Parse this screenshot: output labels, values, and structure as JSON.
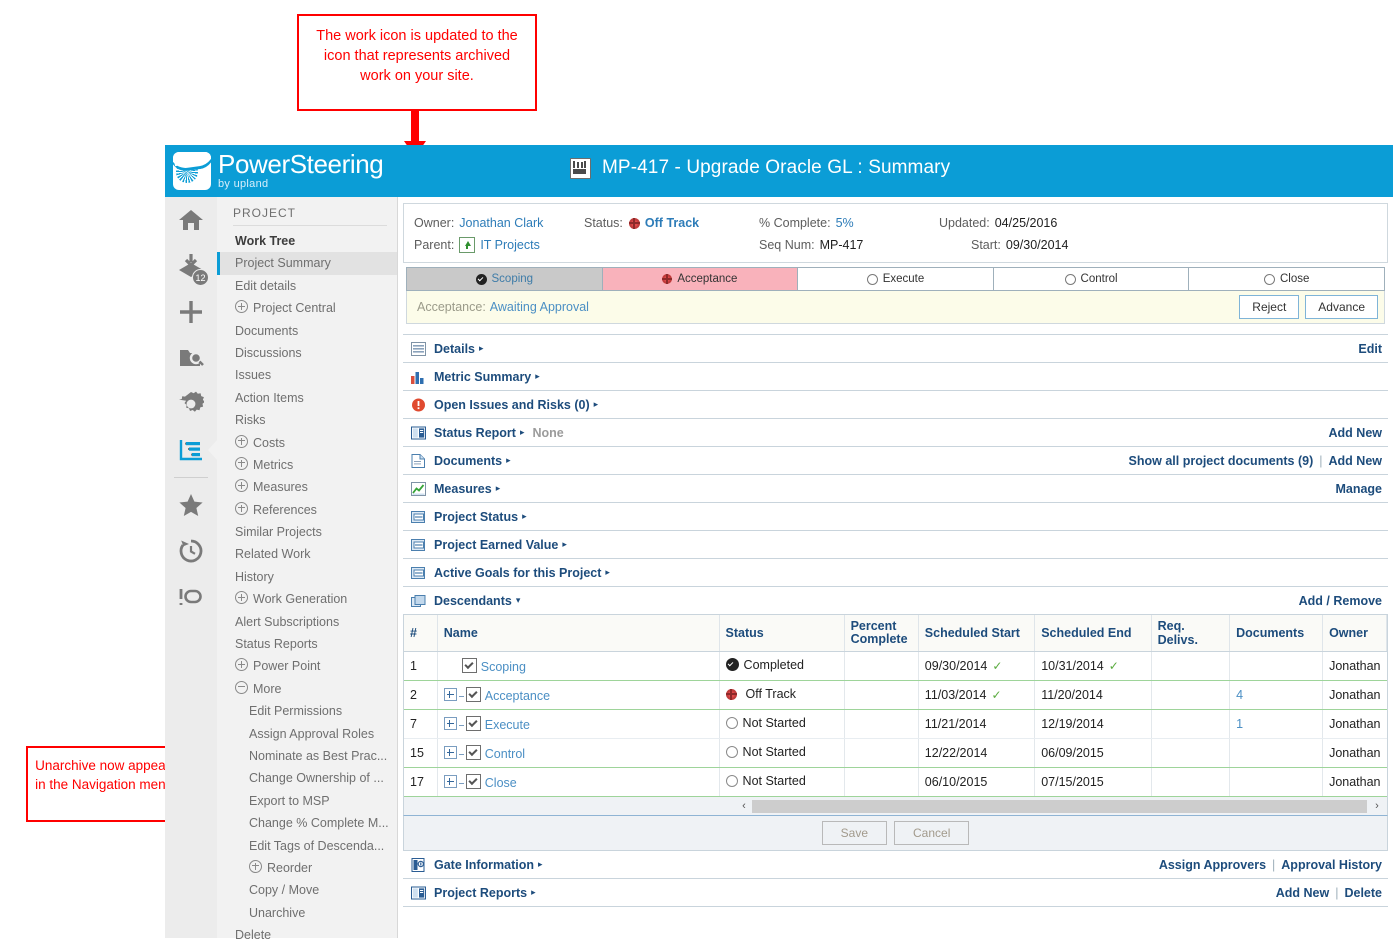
{
  "brand": {
    "name": "PowerSteering",
    "tagline": "by upland",
    "accent": "#0b9dd6"
  },
  "header": {
    "title": "MP-417 - Upgrade Oracle GL : Summary",
    "work_icon": "archive-work-icon"
  },
  "rail": {
    "items": [
      {
        "name": "home-icon"
      },
      {
        "name": "inbox-icon",
        "badge": "12"
      },
      {
        "name": "add-icon"
      },
      {
        "name": "browse-icon"
      },
      {
        "name": "settings-icon"
      },
      {
        "name": "reports-icon",
        "active": true
      },
      {
        "name": "favorites-star-icon"
      },
      {
        "name": "recent-history-icon"
      },
      {
        "name": "links-icon"
      }
    ]
  },
  "nav": {
    "heading": "PROJECT",
    "items": [
      {
        "label": "Work Tree",
        "style": "bold"
      },
      {
        "label": "Project Summary",
        "style": "selected"
      },
      {
        "label": "Edit details"
      },
      {
        "label": "Project Central",
        "toggle": "plus"
      },
      {
        "label": "Documents"
      },
      {
        "label": "Discussions"
      },
      {
        "label": "Issues"
      },
      {
        "label": "Action Items"
      },
      {
        "label": "Risks"
      },
      {
        "label": "Costs",
        "toggle": "plus"
      },
      {
        "label": "Metrics",
        "toggle": "plus"
      },
      {
        "label": "Measures",
        "toggle": "plus"
      },
      {
        "label": "References",
        "toggle": "plus"
      },
      {
        "label": "Similar Projects"
      },
      {
        "label": "Related Work"
      },
      {
        "label": "History"
      },
      {
        "label": "Work Generation",
        "toggle": "plus"
      },
      {
        "label": "Alert Subscriptions"
      },
      {
        "label": "Status Reports"
      },
      {
        "label": "Power Point",
        "toggle": "plus"
      },
      {
        "label": "More",
        "toggle": "minus"
      },
      {
        "label": "Edit Permissions",
        "indent": 1
      },
      {
        "label": "Assign Approval Roles",
        "indent": 1
      },
      {
        "label": "Nominate as Best Prac...",
        "indent": 1
      },
      {
        "label": "Change Ownership of ...",
        "indent": 1
      },
      {
        "label": "Export to MSP",
        "indent": 1
      },
      {
        "label": "Change % Complete M...",
        "indent": 1
      },
      {
        "label": "Edit Tags of Descenda...",
        "indent": 1
      },
      {
        "label": "Reorder",
        "indent": 1,
        "toggle": "plus"
      },
      {
        "label": "Copy / Move",
        "indent": 1
      },
      {
        "label": "Unarchive",
        "indent": 1
      },
      {
        "label": "Delete"
      }
    ]
  },
  "info": {
    "owner_label": "Owner:",
    "owner_value": "Jonathan Clark",
    "status_label": "Status:",
    "status_value": "Off Track",
    "percent_label": "% Complete:",
    "percent_value": "5%",
    "updated_label": "Updated:",
    "updated_value": "04/25/2016",
    "parent_label": "Parent:",
    "parent_value": "IT Projects",
    "seq_label": "Seq Num:",
    "seq_value": "MP-417",
    "start_label": "Start:",
    "start_value": "09/30/2014"
  },
  "phases": [
    {
      "label": "Scoping",
      "state": "done"
    },
    {
      "label": "Acceptance",
      "state": "current"
    },
    {
      "label": "Execute",
      "state": "pending"
    },
    {
      "label": "Control",
      "state": "pending"
    },
    {
      "label": "Close",
      "state": "pending"
    }
  ],
  "approval": {
    "label": "Acceptance:",
    "value": "Awaiting Approval",
    "reject_label": "Reject",
    "advance_label": "Advance"
  },
  "sections": [
    {
      "title": "Details",
      "icon": "grid-icon",
      "caret": "▸",
      "actions": [
        "Edit"
      ]
    },
    {
      "title": "Metric Summary",
      "icon": "bar-chart-icon",
      "caret": "▸",
      "actions": []
    },
    {
      "title": "Open Issues and Risks (0)",
      "icon": "alert-icon",
      "caret": "▸",
      "actions": []
    },
    {
      "title": "Status Report",
      "icon": "book-icon",
      "caret": "▸",
      "note": "None",
      "actions": [
        "Add New"
      ]
    },
    {
      "title": "Documents",
      "icon": "document-icon",
      "caret": "▸",
      "actions": [
        "Show all project documents (9)",
        "Add New"
      ]
    },
    {
      "title": "Measures",
      "icon": "line-chart-icon",
      "caret": "▸",
      "actions": [
        "Manage"
      ]
    },
    {
      "title": "Project Status",
      "icon": "report-icon",
      "caret": "▸",
      "actions": []
    },
    {
      "title": "Project Earned Value",
      "icon": "report-icon",
      "caret": "▸",
      "actions": []
    },
    {
      "title": "Active Goals for this Project",
      "icon": "report-icon",
      "caret": "▸",
      "actions": []
    },
    {
      "title": "Descendants",
      "icon": "stack-icon",
      "caret": "▾",
      "actions": [
        "Add / Remove"
      ]
    }
  ],
  "descendants": {
    "columns": [
      "#",
      "Name",
      "Status",
      "Percent Complete",
      "Scheduled Start",
      "Scheduled End",
      "Req. Delivs.",
      "Documents",
      "Owner"
    ],
    "rows": [
      {
        "num": "1",
        "name": "Scoping",
        "expandable": false,
        "status": "Completed",
        "status_icon": "check-filled",
        "percent": "",
        "start": "09/30/2014",
        "start_check": true,
        "end": "10/31/2014",
        "end_check": true,
        "delivs": "",
        "documents": "",
        "owner": "Jonathan"
      },
      {
        "num": "2",
        "name": "Acceptance",
        "expandable": true,
        "status": "Off Track",
        "status_icon": "off-track",
        "percent": "",
        "start": "11/03/2014",
        "start_check": true,
        "end": "11/20/2014",
        "end_check": false,
        "delivs": "",
        "documents": "4",
        "owner": "Jonathan"
      },
      {
        "num": "7",
        "name": "Execute",
        "expandable": true,
        "status": "Not Started",
        "status_icon": "circle",
        "percent": "",
        "start": "11/21/2014",
        "start_check": false,
        "end": "12/19/2014",
        "end_check": false,
        "delivs": "",
        "documents": "1",
        "owner": "Jonathan"
      },
      {
        "num": "15",
        "name": "Control",
        "expandable": true,
        "status": "Not Started",
        "status_icon": "circle",
        "percent": "",
        "start": "12/22/2014",
        "start_check": false,
        "end": "06/09/2015",
        "end_check": false,
        "delivs": "",
        "documents": "",
        "owner": "Jonathan"
      },
      {
        "num": "17",
        "name": "Close",
        "expandable": true,
        "status": "Not Started",
        "status_icon": "circle",
        "percent": "",
        "start": "06/10/2015",
        "start_check": false,
        "end": "07/15/2015",
        "end_check": false,
        "delivs": "",
        "documents": "",
        "owner": "Jonathan"
      }
    ],
    "scroll_left": "‹",
    "scroll_right": "›"
  },
  "formbar": {
    "save_label": "Save",
    "cancel_label": "Cancel"
  },
  "footer_sections": [
    {
      "title": "Gate Information",
      "icon": "gate-icon",
      "caret": "▸",
      "actions": [
        "Assign Approvers",
        "Approval History"
      ]
    },
    {
      "title": "Project Reports",
      "icon": "book-icon",
      "caret": "▸",
      "actions": [
        "Add New",
        "Delete"
      ]
    }
  ],
  "annotations": [
    {
      "id": "work-icon-note",
      "text": "The work icon is updated to the icon that represents archived work on your site."
    },
    {
      "id": "unarchive-note",
      "text": "Unarchive now appears in the Navigation menu."
    }
  ]
}
